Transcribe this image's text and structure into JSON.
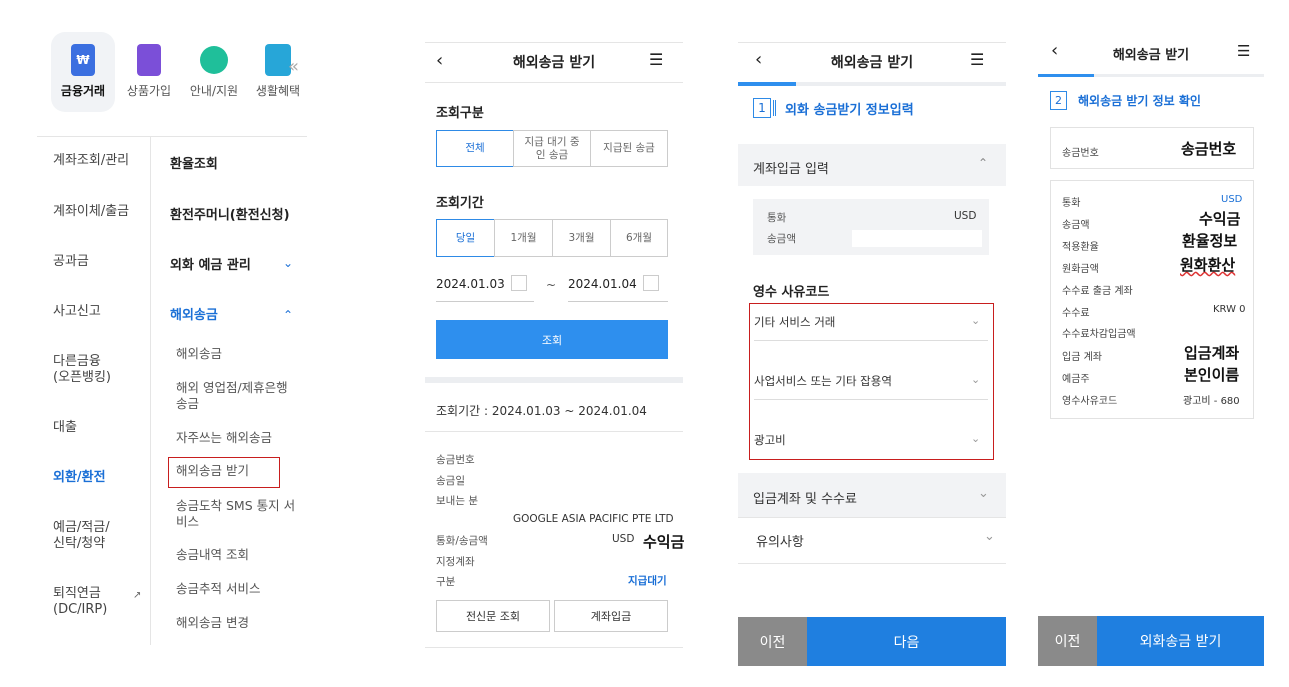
{
  "panel1": {
    "quick_menu": [
      {
        "label": "금융거래",
        "icon": "won-card-icon"
      },
      {
        "label": "상품가입",
        "icon": "shopping-bag-icon"
      },
      {
        "label": "안내/지원",
        "icon": "headset-icon"
      },
      {
        "label": "생활혜택",
        "icon": "gift-icon"
      }
    ],
    "left_menu": [
      "계좌조회/관리",
      "계좌이체/출금",
      "공과금",
      "사고신고",
      "다른금융\n(오픈뱅킹)",
      "대출",
      "외환/환전",
      "예금/적금/\n신탁/청약",
      "퇴직연금\n(DC/IRP)"
    ],
    "right_menu": [
      "환율조회",
      "환전주머니(환전신청)",
      "외화 예금 관리",
      "해외송금"
    ],
    "sub_menu": [
      "해외송금",
      "해외 영업점/제휴은행 송금",
      "자주쓰는 해외송금",
      "해외송금 받기",
      "송금도착 SMS 통지 서비스",
      "송금내역 조회",
      "송금추적 서비스",
      "해외송금 변경"
    ]
  },
  "panel2": {
    "title": "해외송금 받기",
    "section1": "조회구분",
    "type_tabs": [
      "전체",
      "지급 대기 중인 송금",
      "지급된 송금"
    ],
    "section2": "조회기간",
    "period_tabs": [
      "당일",
      "1개월",
      "3개월",
      "6개월"
    ],
    "date_from": "2024.01.03",
    "date_sep": "~",
    "date_to": "2024.01.04",
    "search_button": "조회",
    "period_text": "조회기간 : 2024.01.03 ~ 2024.01.04",
    "labels": [
      "송금번호",
      "송금일",
      "보내는 분"
    ],
    "sender": "GOOGLE ASIA PACIFIC PTE LTD",
    "currency_label": "통화/송금액",
    "currency": "USD",
    "amount_note": "수익금",
    "account_label": "지정계좌",
    "type_label": "구분",
    "status": "지급대기",
    "btn_telegram": "전신문 조회",
    "btn_deposit": "계좌입금"
  },
  "panel3": {
    "title": "해외송금 받기",
    "step_num": "1",
    "step_title": "외화 송금받기 정보입력",
    "section_deposit": "계좌입금 입력",
    "currency_label": "통화",
    "currency": "USD",
    "amount_label": "송금액",
    "reason_title": "영수 사유코드",
    "reasons": [
      "기타 서비스 거래",
      "사업서비스 또는 기타 잡용역",
      "광고비"
    ],
    "section_fee": "입금계좌 및 수수료",
    "section_notice": "유의사항",
    "btn_prev": "이전",
    "btn_next": "다음"
  },
  "panel4": {
    "title": "해외송금 받기",
    "step_num": "2",
    "step_title": "해외송금 받기 정보 확인",
    "remit_label": "송금번호",
    "remit_note": "송금번호",
    "rows": [
      {
        "label": "통화",
        "value": "USD",
        "note": ""
      },
      {
        "label": "송금액",
        "value": "",
        "note": "수익금"
      },
      {
        "label": "적용환율",
        "value": "",
        "note": "환율정보"
      },
      {
        "label": "원화금액",
        "value": "",
        "note": "원화환산"
      },
      {
        "label": "수수료 출금 계좌",
        "value": "",
        "note": ""
      },
      {
        "label": "수수료",
        "value": "KRW 0",
        "note": ""
      },
      {
        "label": "수수료차감입금액",
        "value": "",
        "note": ""
      },
      {
        "label": "입금 계좌",
        "value": "",
        "note": "입금계좌"
      },
      {
        "label": "예금주",
        "value": "",
        "note": "본인이름"
      },
      {
        "label": "영수사유코드",
        "value": "광고비 - 680",
        "note": ""
      }
    ],
    "btn_prev": "이전",
    "btn_receive": "외화송금 받기"
  },
  "colors": {
    "accent": "#1a6fd6",
    "button": "#2e8fee",
    "highlight_box": "#c81e1e",
    "footer_gray": "#8a8a8a"
  }
}
